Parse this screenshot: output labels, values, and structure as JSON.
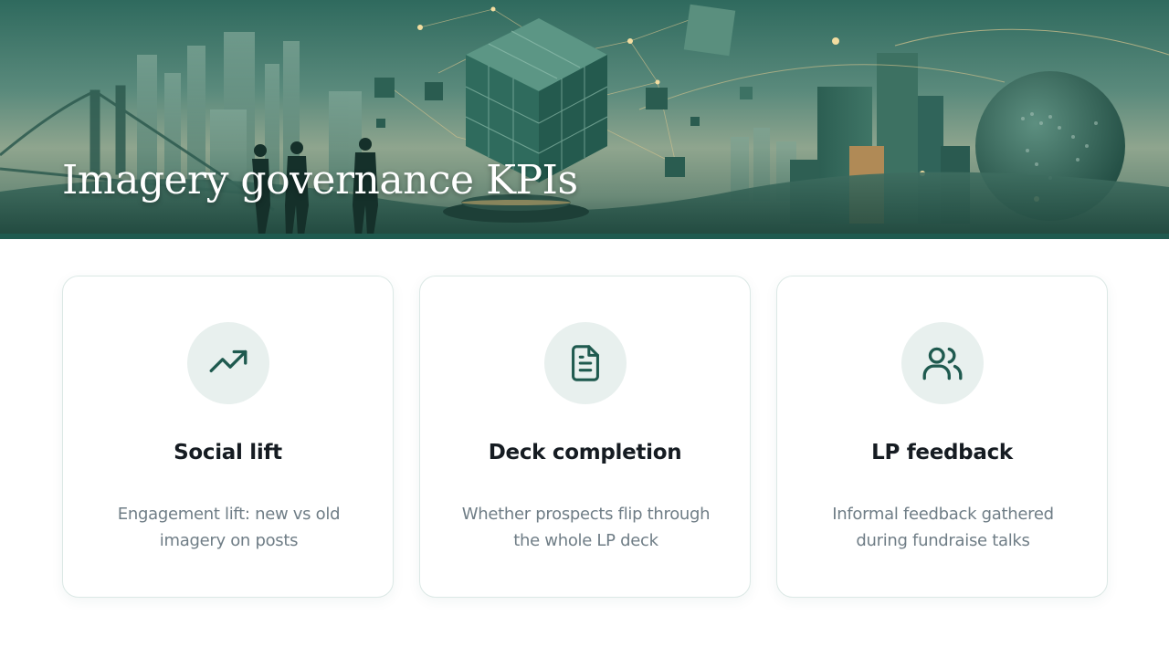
{
  "header": {
    "title": "Imagery governance KPIs"
  },
  "colors": {
    "accent": "#1f5a4f",
    "icon_bg": "#e8f0ee",
    "card_border": "#dbe8e5",
    "title_text": "#161c22",
    "body_text": "#6f7d86"
  },
  "cards": [
    {
      "icon": "trending-up-icon",
      "title": "Social lift",
      "description": "Engagement lift: new vs old imagery on posts"
    },
    {
      "icon": "document-icon",
      "title": "Deck completion",
      "description": "Whether prospects flip through the whole LP deck"
    },
    {
      "icon": "users-icon",
      "title": "LP feedback",
      "description": "Informal feedback gathered during fundraise talks"
    }
  ]
}
